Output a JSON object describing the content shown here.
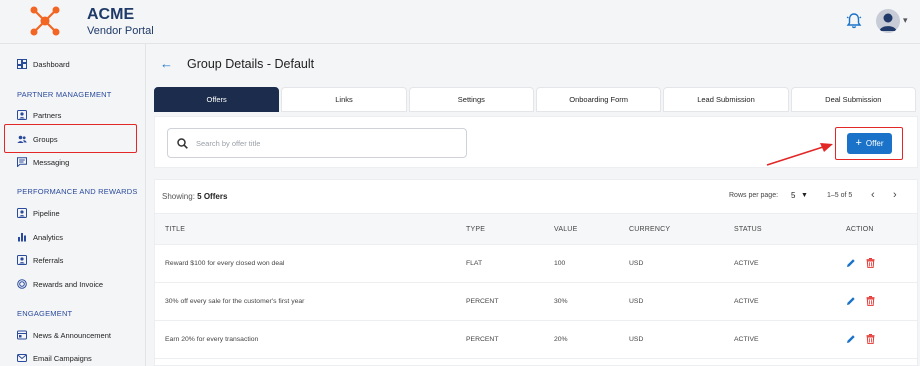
{
  "brand": {
    "title": "ACME",
    "subtitle": "Vendor Portal"
  },
  "sidebar": {
    "dashboard": "Dashboard",
    "section_partner": "PARTNER MANAGEMENT",
    "partners": "Partners",
    "groups": "Groups",
    "messaging": "Messaging",
    "section_performance": "PERFORMANCE AND REWARDS",
    "pipeline": "Pipeline",
    "analytics": "Analytics",
    "referrals": "Referrals",
    "rewards": "Rewards and Invoice",
    "section_engagement": "ENGAGEMENT",
    "news": "News & Announcement",
    "email": "Email Campaigns"
  },
  "page": {
    "title": "Group Details - Default",
    "back_icon": "arrow-left-icon"
  },
  "tabs": [
    "Offers",
    "Links",
    "Settings",
    "Onboarding Form",
    "Lead Submission",
    "Deal Submission"
  ],
  "search": {
    "placeholder": "Search by offer title",
    "value": ""
  },
  "offer_button": {
    "label": "Offer",
    "plus": "+"
  },
  "table": {
    "showing_label": "Showing:",
    "showing_value": "5 Offers",
    "rows_per_page_label": "Rows per page:",
    "rows_per_page_value": "5",
    "range": "1–5 of 5",
    "columns": [
      "TITLE",
      "TYPE",
      "VALUE",
      "CURRENCY",
      "STATUS",
      "ACTION"
    ],
    "rows": [
      {
        "title": "Reward $100 for every closed won deal",
        "type": "FLAT",
        "value": "100",
        "currency": "USD",
        "status": "ACTIVE"
      },
      {
        "title": "30% off every sale for the customer's first year",
        "type": "PERCENT",
        "value": "30%",
        "currency": "USD",
        "status": "ACTIVE"
      },
      {
        "title": "Earn 20% for every transaction",
        "type": "PERCENT",
        "value": "20%",
        "currency": "USD",
        "status": "ACTIVE"
      }
    ]
  },
  "colors": {
    "accent": "#1a73c8",
    "active_tab": "#1c2c4c",
    "highlight": "#e32626",
    "delete": "#e53935",
    "brand_orange": "#f26522"
  }
}
